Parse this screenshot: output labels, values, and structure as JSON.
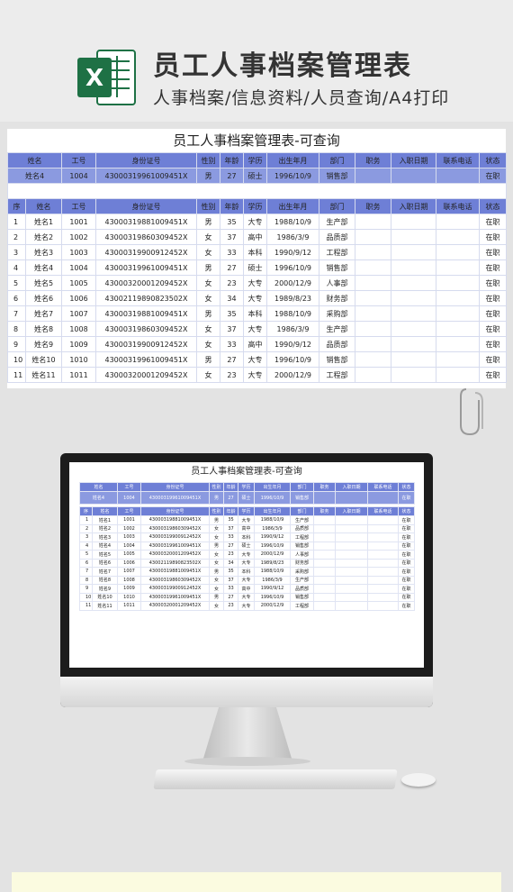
{
  "header": {
    "title": "员工人事档案管理表",
    "subtitle": "人事档案/信息资料/人员查询/A4打印",
    "logo_letter": "X"
  },
  "sheet": {
    "title": "员工人事档案管理表-可查询",
    "query_headers": [
      "姓名",
      "工号",
      "身份证号",
      "性别",
      "年龄",
      "学历",
      "出生年月",
      "部门",
      "职务",
      "入职日期",
      "联系电话",
      "状态"
    ],
    "query_row": [
      "姓名4",
      "1004",
      "43000319961009451X",
      "男",
      "27",
      "硕士",
      "1996/10/9",
      "销售部",
      "",
      "",
      "",
      "在职"
    ],
    "table_headers": [
      "序",
      "姓名",
      "工号",
      "身份证号",
      "性别",
      "年龄",
      "学历",
      "出生年月",
      "部门",
      "职务",
      "入职日期",
      "联系电话",
      "状态"
    ],
    "rows": [
      [
        "1",
        "姓名1",
        "1001",
        "43000319881009451X",
        "男",
        "35",
        "大专",
        "1988/10/9",
        "生产部",
        "",
        "",
        "",
        "在职"
      ],
      [
        "2",
        "姓名2",
        "1002",
        "43000319860309452X",
        "女",
        "37",
        "高中",
        "1986/3/9",
        "品质部",
        "",
        "",
        "",
        "在职"
      ],
      [
        "3",
        "姓名3",
        "1003",
        "43000319900912452X",
        "女",
        "33",
        "本科",
        "1990/9/12",
        "工程部",
        "",
        "",
        "",
        "在职"
      ],
      [
        "4",
        "姓名4",
        "1004",
        "43000319961009451X",
        "男",
        "27",
        "硕士",
        "1996/10/9",
        "销售部",
        "",
        "",
        "",
        "在职"
      ],
      [
        "5",
        "姓名5",
        "1005",
        "43000320001209452X",
        "女",
        "23",
        "大专",
        "2000/12/9",
        "人事部",
        "",
        "",
        "",
        "在职"
      ],
      [
        "6",
        "姓名6",
        "1006",
        "43002119890823502X",
        "女",
        "34",
        "大专",
        "1989/8/23",
        "财务部",
        "",
        "",
        "",
        "在职"
      ],
      [
        "7",
        "姓名7",
        "1007",
        "43000319881009451X",
        "男",
        "35",
        "本科",
        "1988/10/9",
        "采购部",
        "",
        "",
        "",
        "在职"
      ],
      [
        "8",
        "姓名8",
        "1008",
        "43000319860309452X",
        "女",
        "37",
        "大专",
        "1986/3/9",
        "生产部",
        "",
        "",
        "",
        "在职"
      ],
      [
        "9",
        "姓名9",
        "1009",
        "43000319900912452X",
        "女",
        "33",
        "高中",
        "1990/9/12",
        "品质部",
        "",
        "",
        "",
        "在职"
      ],
      [
        "10",
        "姓名10",
        "1010",
        "43000319961009451X",
        "男",
        "27",
        "大专",
        "1996/10/9",
        "销售部",
        "",
        "",
        "",
        "在职"
      ],
      [
        "11",
        "姓名11",
        "1011",
        "43000320001209452X",
        "女",
        "23",
        "大专",
        "2000/12/9",
        "工程部",
        "",
        "",
        "",
        "在职"
      ]
    ]
  },
  "colors": {
    "header_blue": "#6e7fd6",
    "query_blue": "#8b9ae0",
    "excel_green": "#1e7145"
  }
}
